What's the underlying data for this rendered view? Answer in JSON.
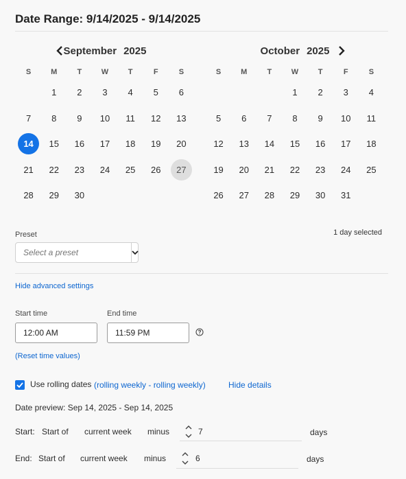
{
  "header": {
    "title": "Date Range: 9/14/2025 - 9/14/2025"
  },
  "calendar": {
    "weekdays": [
      "S",
      "M",
      "T",
      "W",
      "T",
      "F",
      "S"
    ],
    "months": [
      {
        "name": "September",
        "year": "2025",
        "weeks": [
          [
            "",
            "1",
            "2",
            "3",
            "4",
            "5",
            "6"
          ],
          [
            "7",
            "8",
            "9",
            "10",
            "11",
            "12",
            "13"
          ],
          [
            "14",
            "15",
            "16",
            "17",
            "18",
            "19",
            "20"
          ],
          [
            "21",
            "22",
            "23",
            "24",
            "25",
            "26",
            "27"
          ],
          [
            "28",
            "29",
            "30",
            "",
            "",
            "",
            ""
          ]
        ],
        "selected": "14",
        "today": "27"
      },
      {
        "name": "October",
        "year": "2025",
        "weeks": [
          [
            "",
            "",
            "",
            "1",
            "2",
            "3",
            "4"
          ],
          [
            "5",
            "6",
            "7",
            "8",
            "9",
            "10",
            "11"
          ],
          [
            "12",
            "13",
            "14",
            "15",
            "16",
            "17",
            "18"
          ],
          [
            "19",
            "20",
            "21",
            "22",
            "23",
            "24",
            "25"
          ],
          [
            "26",
            "27",
            "28",
            "29",
            "30",
            "31",
            ""
          ]
        ],
        "selected": "",
        "today": ""
      }
    ],
    "nav_icons": {
      "prev": "chevron-left-icon",
      "next": "chevron-right-icon"
    }
  },
  "preset": {
    "label": "Preset",
    "placeholder": "Select a preset",
    "selected_count": "1 day selected"
  },
  "advanced": {
    "hide_link": "Hide advanced settings"
  },
  "time": {
    "start_label": "Start time",
    "start_value": "12:00 AM",
    "end_label": "End time",
    "end_value": "11:59 PM",
    "reset_link": "(Reset time values)"
  },
  "rolling": {
    "checked": true,
    "label": "Use rolling dates",
    "summary": "(rolling weekly - rolling weekly)",
    "hide_details": "Hide details",
    "preview": "Date preview: Sep 14, 2025 - Sep 14, 2025",
    "start": {
      "label": "Start:",
      "anchor": "Start of",
      "period": "current week",
      "op": "minus",
      "amount": "7",
      "unit": "days"
    },
    "end": {
      "label": "End:",
      "anchor": "Start of",
      "period": "current week",
      "op": "minus",
      "amount": "6",
      "unit": "days"
    }
  },
  "colors": {
    "accent": "#1473e6",
    "link": "#0d66d0",
    "background": "#f8f8f8"
  }
}
